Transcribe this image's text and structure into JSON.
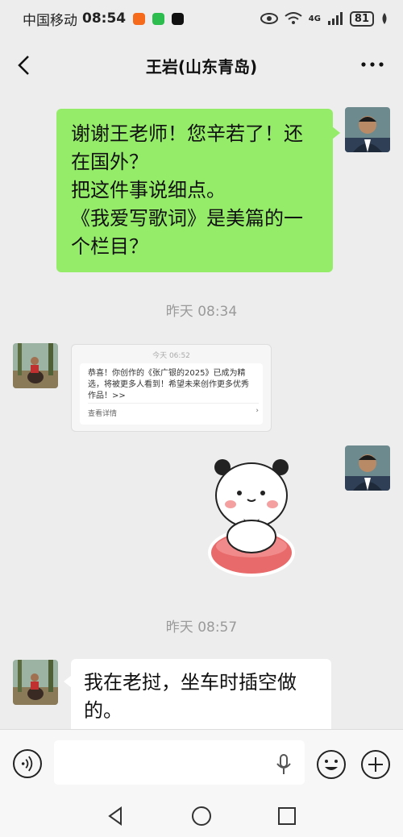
{
  "status_bar": {
    "carrier": "中国移动",
    "time": "08:54",
    "network": "4G",
    "battery": "81"
  },
  "nav": {
    "title": "王岩(山东青岛)"
  },
  "messages": {
    "sent_text": [
      "谢谢王老师！您辛若了！还",
      "在国外？",
      "把这件事说细点。",
      "《我爱写歌词》是美篇的一",
      "个栏目？"
    ],
    "time_1": "昨天 08:34",
    "card": {
      "time": "今天 06:52",
      "text": "恭喜！你创作的《张广银的2025》已成为精选，将被更多人看到！希望未来创作更多优秀作品！>>",
      "link": "查看详情"
    },
    "time_2": "昨天 08:57",
    "received_text": [
      "我在老挝，坐车时插空做",
      "的。"
    ]
  },
  "colors": {
    "sent_bubble": "#95ec69",
    "background": "#ededed"
  }
}
